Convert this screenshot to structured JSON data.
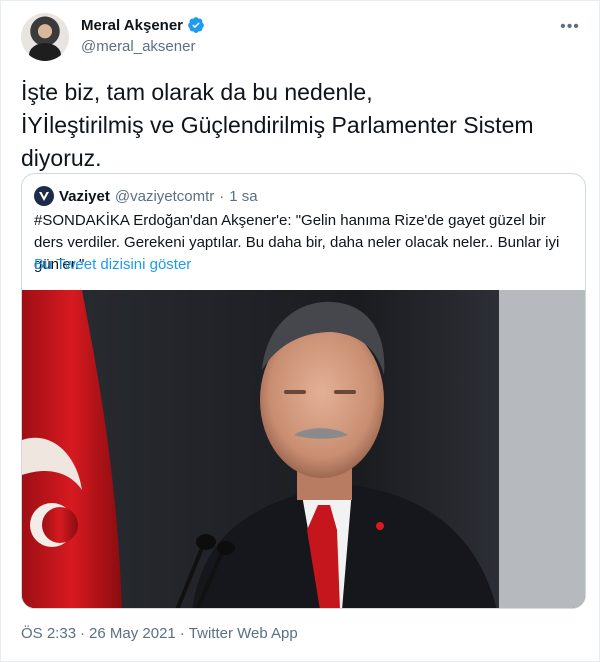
{
  "author": {
    "name": "Meral Akşener",
    "handle": "@meral_aksener",
    "verified_icon": "verified-badge-icon",
    "verified_color": "#1d9bf0"
  },
  "tweet": {
    "lines": [
      "İşte biz, tam olarak da bu nedenle,",
      "İYİleştirilmiş ve Güçlendirilmiş Parlamenter Sistem",
      "diyoruz."
    ]
  },
  "quoted": {
    "name": "Vaziyet",
    "handle": "@vaziyetcomtr",
    "dot": "·",
    "time": "1 sa",
    "text": "#SONDAKİKA Erdoğan'dan Akşener'e: \"Gelin hanıma Rize'de gayet güzel bir ders verdiler. Gerekeni yaptılar. Bu daha bir, daha neler olacak neler.. Bunlar iyi günler.\"",
    "thread_link": "Bu Tweet dizisini göster",
    "link_color": "#1d9bf0"
  },
  "footer": {
    "time": "ÖS 2:33",
    "sep1": "·",
    "date": "26 May 2021",
    "sep2": "·",
    "source": "Twitter Web App"
  },
  "colors": {
    "text": "#0f1419",
    "secondary": "#5b7083",
    "border": "#cfd9de"
  }
}
